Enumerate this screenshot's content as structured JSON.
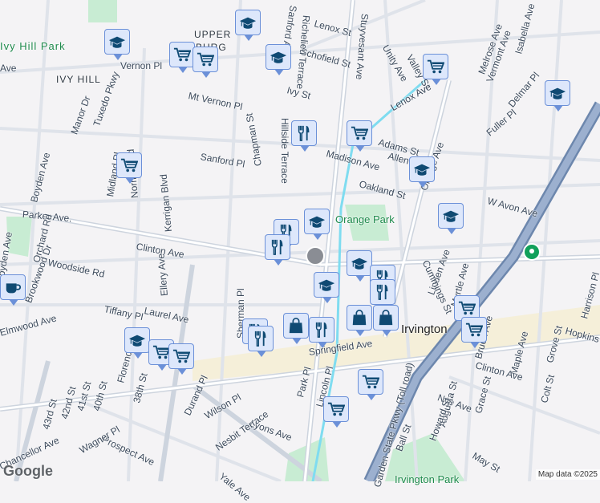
{
  "streets": [
    "Lenox St",
    "Schofield St",
    "Ivy St",
    "Mt Vernon Pl",
    "Sanford Pl",
    "Parker Ave.",
    "Clinton Ave",
    "Woodside Rd",
    "Laurel Ave",
    "Tiffany Pl",
    "Elmwood Ave",
    "Springfield Ave",
    "Lyons Ave",
    "Prospect Ave",
    "Chancellor Ave",
    "Stuyvesant Ave",
    "Sanford Ave",
    "Valley St",
    "Unity Ave",
    "Lenox Ave",
    "Adams St",
    "Madison Ave",
    "Allen St",
    "Oakland St",
    "Fuller Pl",
    "W Avon Ave",
    "Delmar Pl",
    "Melrose Ave",
    "Vermont Ave",
    "Isabella Ave",
    "Linden Ave",
    "Myrtle Ave",
    "Bruen Ave",
    "Maple Ave",
    "Grove St",
    "Harrison Pl",
    "Hopkins Pl",
    "Clinton Ave",
    "Nye Ave",
    "Colt St",
    "Grace St",
    "Augusta St",
    "Howard St",
    "Ball St",
    "May St",
    "Cummings St",
    "Chapman St",
    "Hillside Terrace",
    "Sherman Pl",
    "Kerrigan Blvd",
    "Ellery Ave",
    "Norman Rd",
    "Tuxedo Pkwy",
    "Midland Pl",
    "Manor Dr",
    "Boyden Ave",
    "Orchard Rd",
    "Brookwood Dr",
    "Durand Pl",
    "Wilson Pl",
    "Nesbit Terrace",
    "Yale Ave",
    "Park Pl",
    "Lincoln Pl",
    "40th St",
    "38th St",
    "41st St",
    "42nd St",
    "43rd St",
    "Wagner Pl",
    "Florence Ave",
    "Garden State Pkwy (Toll road)",
    "Richelieu Terrace",
    "Orange Ave",
    "Boyden Ave",
    "Vernon Pl",
    "Ave"
  ],
  "places": {
    "ivy_hill_park": "Ivy Hill Park",
    "ivy_hill": "IVY HILL",
    "upper": "UPPER",
    "burg": "BURG",
    "orange_park": "Orange Park",
    "irvington": "Irvington",
    "irvington_park": "Irvington Park"
  },
  "attribution": {
    "logo": "Google",
    "map_data": "Map data ©2025"
  },
  "markers": {
    "school": 10,
    "grocery": 11,
    "restaurant": 8,
    "shopping": 3,
    "cafe": 1
  },
  "colors": {
    "marker_fill": "#dde7fb",
    "marker_border": "#6b90d8",
    "icon": "#0f4a73",
    "park": "#c6ecd2",
    "highway": "#7f99c0"
  }
}
